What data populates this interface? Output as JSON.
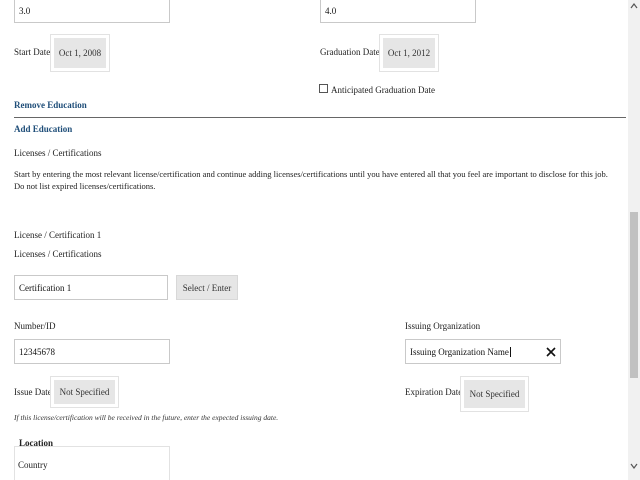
{
  "education": {
    "gpa_value": "3.0",
    "gpa2_value": "4.0",
    "start_date_label": "Start Date",
    "start_date_value": "Oct 1, 2008",
    "graduation_date_label": "Graduation Date",
    "graduation_date_value": "Oct 1, 2012",
    "anticipated_label": "Anticipated Graduation Date",
    "remove_link": "Remove Education",
    "add_link": "Add Education"
  },
  "licenses": {
    "section_title": "Licenses / Certifications",
    "instructions_line1": "Start by entering the most relevant license/certification and continue adding licenses/certifications until you have entered all that you feel are important to disclose for this job.",
    "instructions_line2": "Do not list expired licenses/certifications.",
    "item_title": "License / Certification 1",
    "field_label": "Licenses / Certifications",
    "certification_value": "Certification 1",
    "select_button": "Select / Enter",
    "number_label": "Number/ID",
    "number_value": "12345678",
    "issuing_label": "Issuing Organization",
    "issuing_value": "Issuing Organization Name",
    "issue_date_label": "Issue Date",
    "issue_date_value": "Not Specified",
    "expiration_date_label": "Expiration Date",
    "expiration_date_value": "Not Specified",
    "future_note": "If this license/certification will be received in the future, enter the expected issuing date.",
    "location_title": "Location",
    "country_label": "Country"
  },
  "icons": {
    "clear": "close-icon",
    "scroll_up": "chevron-up-icon",
    "scroll_down": "chevron-down-icon"
  },
  "colors": {
    "link": "#1f4e79",
    "button_bg": "#e6e6e6"
  }
}
